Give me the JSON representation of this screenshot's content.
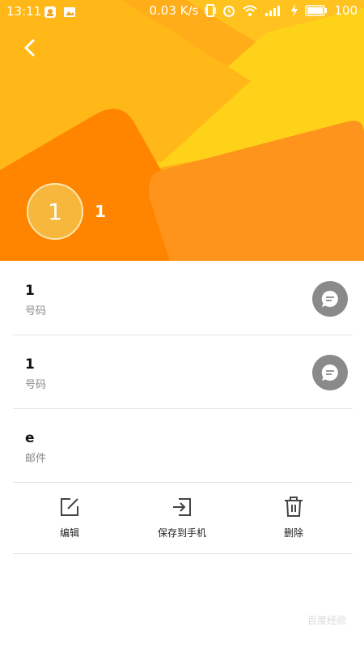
{
  "status_bar": {
    "time": "13:11",
    "network_speed": "0.03 K/s",
    "battery": "100"
  },
  "header": {
    "avatar_text": "1",
    "contact_name": "1",
    "accent": "#ff8a00"
  },
  "fields": [
    {
      "value": "1",
      "label": "号码"
    },
    {
      "value": "1",
      "label": "号码"
    },
    {
      "value": "e",
      "label": "邮件"
    }
  ],
  "actions": {
    "edit": "编辑",
    "save_to_phone": "保存到手机",
    "delete": "删除"
  },
  "watermark": "百度经验"
}
